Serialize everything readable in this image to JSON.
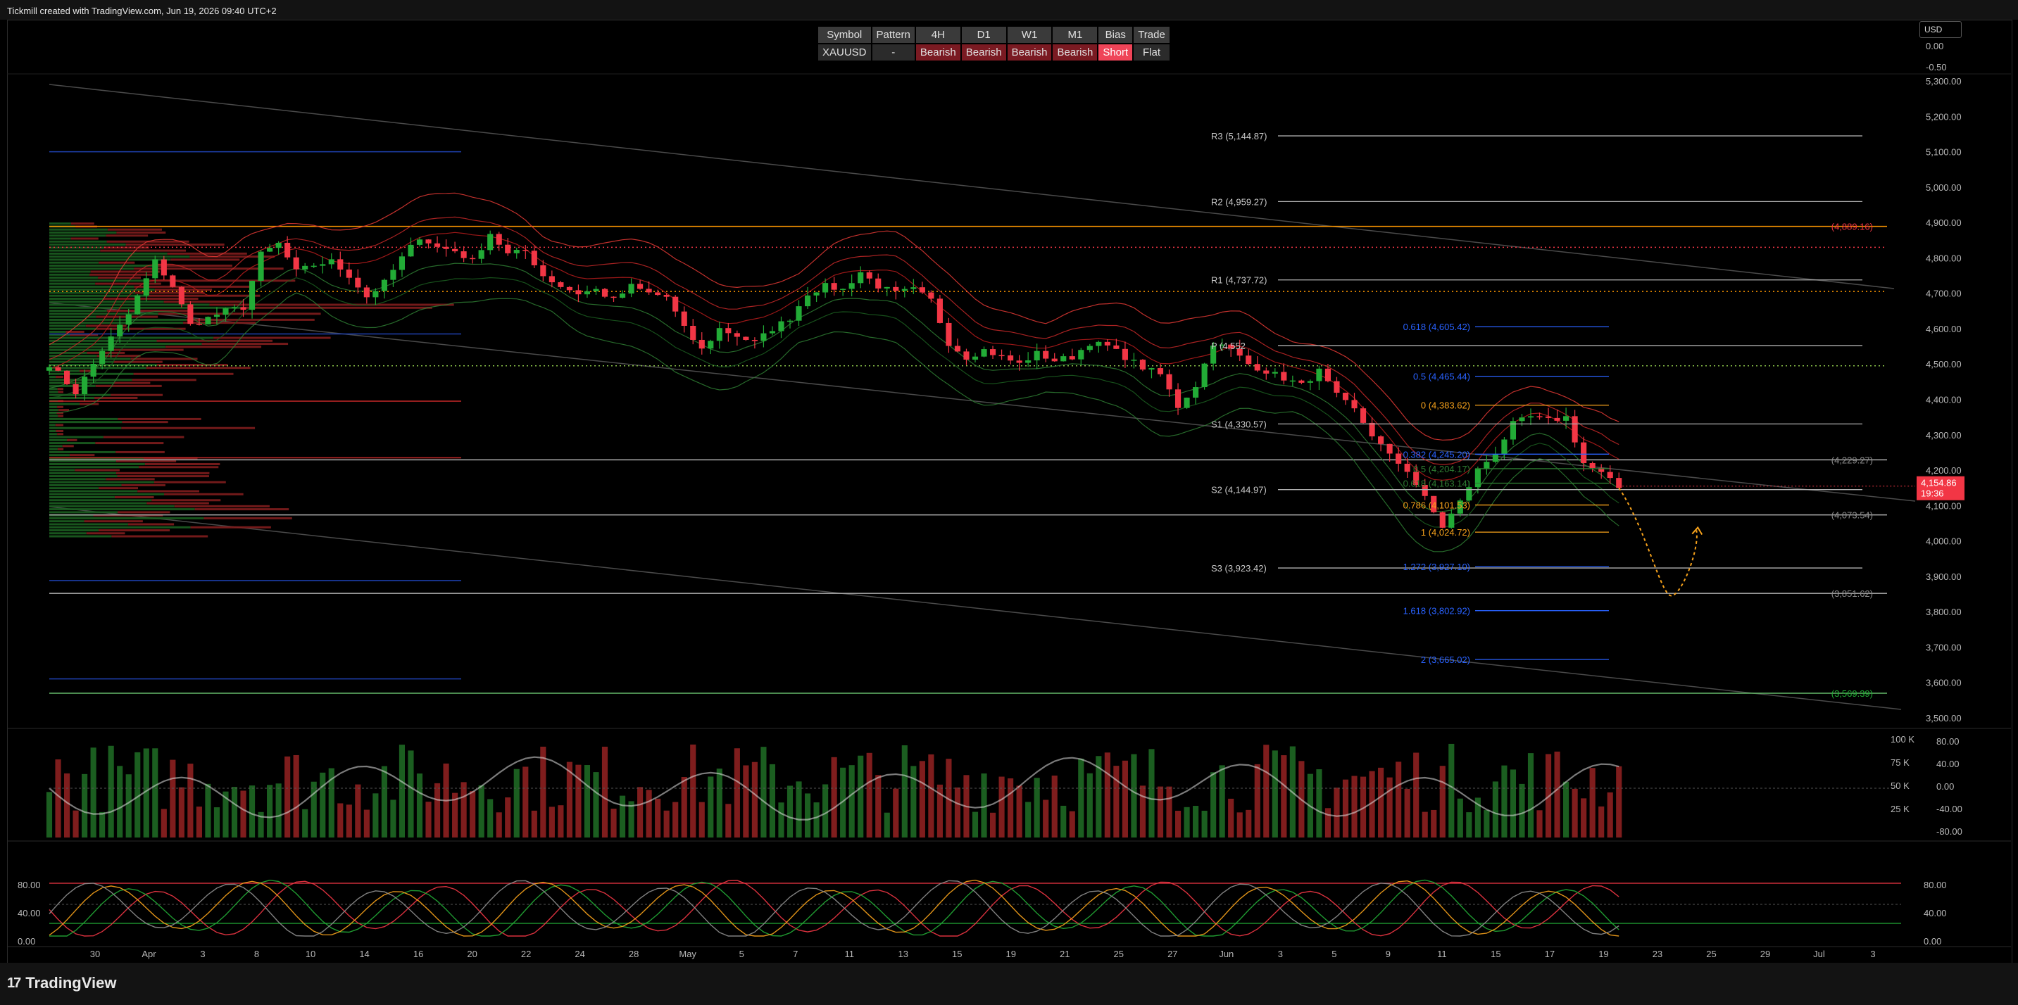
{
  "header": {
    "text": "Tickmill created with TradingView.com, Jun 19, 2026 09:40 UTC+2"
  },
  "footer": {
    "brand": "TradingView",
    "logo_glyph": "17"
  },
  "currency": "USD",
  "status_table": {
    "headers": [
      "Symbol",
      "Pattern",
      "4H",
      "D1",
      "W1",
      "M1",
      "Bias",
      "Trade"
    ],
    "row": [
      "XAUUSD",
      "-",
      "Bearish",
      "Bearish",
      "Bearish",
      "Bearish",
      "Short",
      "Flat"
    ]
  },
  "colors": {
    "up": "#22ab36",
    "down": "#f23645",
    "pivot": "#b0b0b0",
    "fib": "#2962ff",
    "price_tag": "#f23645",
    "forecast": "#f7a21b"
  },
  "chart_data": {
    "type": "candlestick",
    "symbol": "XAUUSD",
    "ylim": [
      3480,
      5320
    ],
    "y_ticks": [
      "5,300.00",
      "5,200.00",
      "5,100.00",
      "5,000.00",
      "4,900.00",
      "4,800.00",
      "4,700.00",
      "4,600.00",
      "4,500.00",
      "4,400.00",
      "4,300.00",
      "4,200.00",
      "4,100.00",
      "4,000.00",
      "3,900.00",
      "3,800.00",
      "3,700.00",
      "3,600.00",
      "3,500.00"
    ],
    "top_scale_ticks": [
      "0.00",
      "-0.50"
    ],
    "x_tick_labels": [
      "30",
      "Apr",
      "3",
      "8",
      "10",
      "14",
      "16",
      "20",
      "22",
      "24",
      "28",
      "May",
      "5",
      "7",
      "11",
      "13",
      "15",
      "19",
      "21",
      "25",
      "27",
      "Jun",
      "3",
      "5",
      "9",
      "11",
      "15",
      "17",
      "19",
      "23",
      "25",
      "29",
      "Jul",
      "3"
    ],
    "close_path": [
      [
        0,
        4500
      ],
      [
        3,
        4420
      ],
      [
        6,
        4540
      ],
      [
        9,
        4640
      ],
      [
        12,
        4790
      ],
      [
        14,
        4720
      ],
      [
        16,
        4610
      ],
      [
        18,
        4630
      ],
      [
        20,
        4650
      ],
      [
        22,
        4660
      ],
      [
        24,
        4810
      ],
      [
        26,
        4840
      ],
      [
        28,
        4760
      ],
      [
        30,
        4780
      ],
      [
        32,
        4790
      ],
      [
        34,
        4750
      ],
      [
        36,
        4690
      ],
      [
        38,
        4730
      ],
      [
        40,
        4800
      ],
      [
        42,
        4860
      ],
      [
        44,
        4830
      ],
      [
        46,
        4820
      ],
      [
        48,
        4790
      ],
      [
        50,
        4870
      ],
      [
        52,
        4810
      ],
      [
        54,
        4820
      ],
      [
        56,
        4750
      ],
      [
        58,
        4720
      ],
      [
        60,
        4700
      ],
      [
        62,
        4710
      ],
      [
        64,
        4680
      ],
      [
        66,
        4720
      ],
      [
        68,
        4700
      ],
      [
        70,
        4690
      ],
      [
        72,
        4600
      ],
      [
        74,
        4540
      ],
      [
        76,
        4600
      ],
      [
        78,
        4580
      ],
      [
        80,
        4560
      ],
      [
        82,
        4600
      ],
      [
        84,
        4630
      ],
      [
        86,
        4700
      ],
      [
        88,
        4720
      ],
      [
        90,
        4710
      ],
      [
        92,
        4760
      ],
      [
        94,
        4720
      ],
      [
        96,
        4700
      ],
      [
        98,
        4710
      ],
      [
        100,
        4680
      ],
      [
        102,
        4560
      ],
      [
        104,
        4520
      ],
      [
        106,
        4540
      ],
      [
        108,
        4520
      ],
      [
        110,
        4500
      ],
      [
        112,
        4530
      ],
      [
        114,
        4510
      ],
      [
        116,
        4520
      ],
      [
        118,
        4560
      ],
      [
        120,
        4550
      ],
      [
        122,
        4520
      ],
      [
        124,
        4490
      ],
      [
        126,
        4470
      ],
      [
        128,
        4380
      ],
      [
        130,
        4440
      ],
      [
        132,
        4560
      ],
      [
        134,
        4540
      ],
      [
        136,
        4500
      ],
      [
        138,
        4480
      ],
      [
        140,
        4460
      ],
      [
        142,
        4440
      ],
      [
        144,
        4480
      ],
      [
        146,
        4410
      ],
      [
        148,
        4370
      ],
      [
        150,
        4300
      ],
      [
        152,
        4240
      ],
      [
        154,
        4200
      ],
      [
        156,
        4120
      ],
      [
        158,
        4040
      ],
      [
        160,
        4110
      ],
      [
        162,
        4200
      ],
      [
        164,
        4250
      ],
      [
        166,
        4330
      ],
      [
        168,
        4350
      ],
      [
        170,
        4340
      ],
      [
        172,
        4350
      ],
      [
        174,
        4220
      ],
      [
        176,
        4190
      ],
      [
        178,
        4150
      ]
    ],
    "visible_last_index": 178,
    "current_price": "4,154.86",
    "countdown": "19:36",
    "pivots": [
      {
        "label": "R3 (5,144.87)",
        "value": 5144.87
      },
      {
        "label": "R2 (4,959.27)",
        "value": 4959.27
      },
      {
        "label": "R1 (4,737.72)",
        "value": 4737.72
      },
      {
        "label": "P (4,552",
        "value": 4552.0
      },
      {
        "label": "S1 (4,330.57)",
        "value": 4330.57
      },
      {
        "label": "S2 (4,144.97)",
        "value": 4144.97
      },
      {
        "label": "S3 (3,923.42)",
        "value": 3923.42
      }
    ],
    "fibs": [
      {
        "label": "0.618 (4,605.42)",
        "value": 4605.42,
        "color": "#2962ff"
      },
      {
        "label": "0.5 (4,465.44)",
        "value": 4465.44,
        "color": "#2962ff"
      },
      {
        "label": "0 (4,383.62)",
        "value": 4383.62,
        "color": "#f7a21b"
      },
      {
        "label": "0.382 (4,245.20)",
        "value": 4245.2,
        "color": "#2962ff"
      },
      {
        "label": "0.5 (4,204.17)",
        "value": 4204.17,
        "color": "#2e7d32"
      },
      {
        "label": "0.618 (4,163.14)",
        "value": 4163.14,
        "color": "#2e7d32"
      },
      {
        "label": "0.786 (4,101.53)",
        "value": 4101.53,
        "color": "#f7a21b"
      },
      {
        "label": "1 (4,024.72)",
        "value": 4024.72,
        "color": "#f7a21b"
      },
      {
        "label": "1.272 (3,927.10)",
        "value": 3927.1,
        "color": "#2962ff"
      },
      {
        "label": "1.618 (3,802.92)",
        "value": 3802.92,
        "color": "#2962ff"
      },
      {
        "label": "2 (3,665.02)",
        "value": 3665.02,
        "color": "#2962ff"
      }
    ],
    "right_labels": [
      {
        "text": "(4,889.16)",
        "value": 4889.16,
        "color": "#f23645"
      },
      {
        "text": "(4,229.27)",
        "value": 4229.27,
        "color": "#8a8a8a"
      },
      {
        "text": "(4,073.54)",
        "value": 4073.54,
        "color": "#8a8a8a"
      },
      {
        "text": "(3,851.62)",
        "value": 3851.62,
        "color": "#8a8a8a"
      },
      {
        "text": "(3,569.39)",
        "value": 3569.39,
        "color": "#22ab36"
      }
    ],
    "horizontal_levels": [
      {
        "value": 4889.16,
        "color": "#ff9800",
        "style": "solid"
      },
      {
        "value": 4830,
        "color": "#f23645",
        "style": "dotted"
      },
      {
        "value": 4705,
        "color": "#ff9800",
        "style": "dotted"
      },
      {
        "value": 4495,
        "color": "#8bc34a",
        "style": "dotted"
      },
      {
        "value": 4229.27,
        "color": "#b0b0b0",
        "style": "solid"
      },
      {
        "value": 4073.54,
        "color": "#b0b0b0",
        "style": "solid"
      },
      {
        "value": 3851.62,
        "color": "#b0b0b0",
        "style": "solid"
      },
      {
        "value": 3569.39,
        "color": "#66bb6a",
        "style": "solid"
      }
    ],
    "volume_panel": {
      "ticks": [
        "100 K",
        "75 K",
        "50 K",
        "25 K"
      ],
      "osc_ticks": [
        "80.00",
        "40.00",
        "0.00",
        "-40.00",
        "-80.00"
      ]
    },
    "stoch_panel": {
      "ticks": [
        "80.00",
        "40.00",
        "0.00"
      ]
    }
  }
}
